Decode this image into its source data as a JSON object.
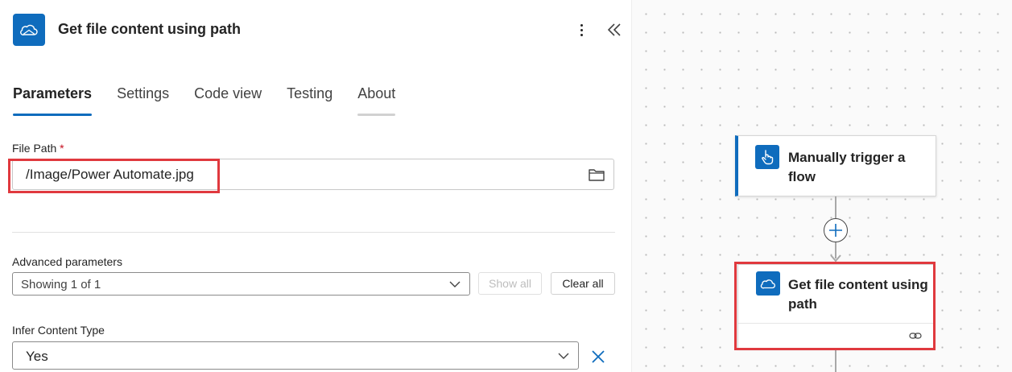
{
  "panel": {
    "title": "Get file content using path",
    "icon": "onedrive-cloud-icon",
    "more_icon": "more-vertical-icon",
    "collapse_icon": "double-chevron-left-icon"
  },
  "tabs": [
    {
      "label": "Parameters",
      "active": true
    },
    {
      "label": "Settings",
      "active": false
    },
    {
      "label": "Code view",
      "active": false
    },
    {
      "label": "Testing",
      "active": false
    },
    {
      "label": "About",
      "active": false
    }
  ],
  "file_path": {
    "label": "File Path",
    "required_mark": "*",
    "value": "/Image/Power Automate.jpg",
    "icon": "folder-icon"
  },
  "advanced": {
    "label": "Advanced parameters",
    "selected": "Showing 1 of 1",
    "show_all_label": "Show all",
    "clear_all_label": "Clear all"
  },
  "infer": {
    "label": "Infer Content Type",
    "selected": "Yes",
    "remove_icon": "close-icon"
  },
  "canvas": {
    "trigger_card": {
      "title_line1": "Manually trigger a",
      "title_line2": "flow",
      "icon": "touch-trigger-icon"
    },
    "action_card": {
      "title_line1": "Get file content using",
      "title_line2": "path",
      "icon": "onedrive-cloud-icon",
      "footer_icon": "link-icon"
    },
    "add_step_icon": "plus-circle-icon"
  },
  "colors": {
    "accent": "#0f6cbd",
    "highlight": "#e0393e",
    "required": "#c50f1f"
  }
}
